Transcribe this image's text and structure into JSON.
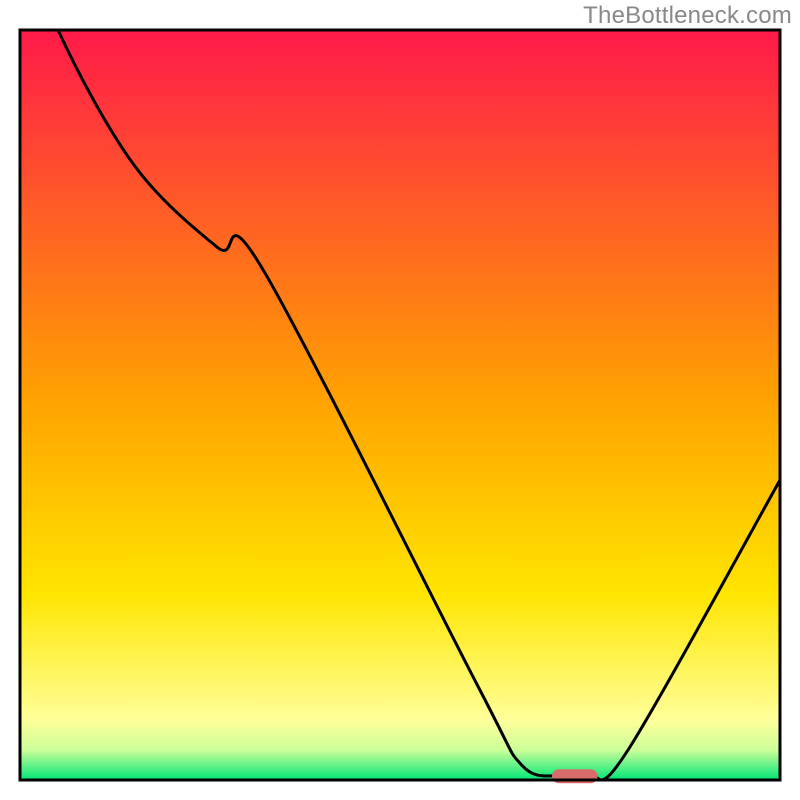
{
  "attribution": "TheBottleneck.com",
  "chart_data": {
    "type": "line",
    "title": "",
    "xlabel": "",
    "ylabel": "",
    "xlim": [
      0,
      100
    ],
    "ylim": [
      0,
      100
    ],
    "x": [
      0,
      5,
      15,
      26,
      32,
      60,
      66,
      71,
      75,
      80,
      100
    ],
    "values": [
      115,
      100,
      82,
      71,
      68,
      13,
      2,
      0.5,
      0.5,
      4,
      40
    ],
    "marker": {
      "x_start": 70,
      "x_end": 76,
      "y": 0.5
    },
    "gradient_stops": [
      {
        "offset": 0,
        "color": "#ff1a4a"
      },
      {
        "offset": 0.5,
        "color": "#ffa400"
      },
      {
        "offset": 0.75,
        "color": "#ffe500"
      },
      {
        "offset": 0.92,
        "color": "#ffff99"
      },
      {
        "offset": 0.96,
        "color": "#ccff99"
      },
      {
        "offset": 1.0,
        "color": "#00e676"
      }
    ],
    "marker_color": "#d96b6b",
    "curve_color": "#000000",
    "frame_color": "#000000"
  }
}
